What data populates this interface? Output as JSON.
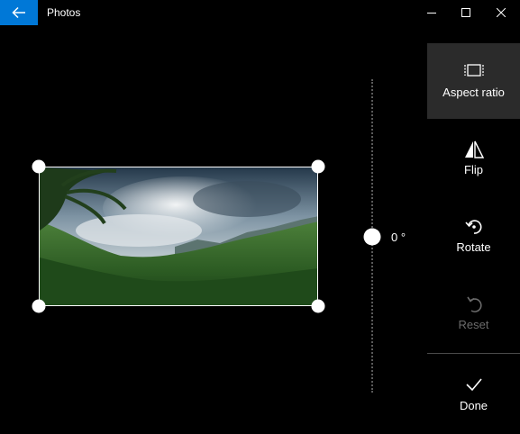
{
  "window": {
    "title": "Photos"
  },
  "rotation": {
    "angle_text": "0 °"
  },
  "tools": {
    "aspect_ratio": "Aspect ratio",
    "flip": "Flip",
    "rotate": "Rotate",
    "reset": "Reset",
    "done": "Done"
  },
  "colors": {
    "accent": "#0078d7",
    "background": "#000000",
    "selected_tool_bg": "#2b2b2b",
    "disabled_text": "#6b6b6b"
  },
  "icons": {
    "back": "back-arrow-icon",
    "minimize": "minimize-icon",
    "maximize": "maximize-icon",
    "close": "close-icon",
    "aspect_ratio": "aspect-ratio-icon",
    "flip": "flip-icon",
    "rotate": "rotate-icon",
    "reset": "reset-icon",
    "done": "checkmark-icon"
  }
}
